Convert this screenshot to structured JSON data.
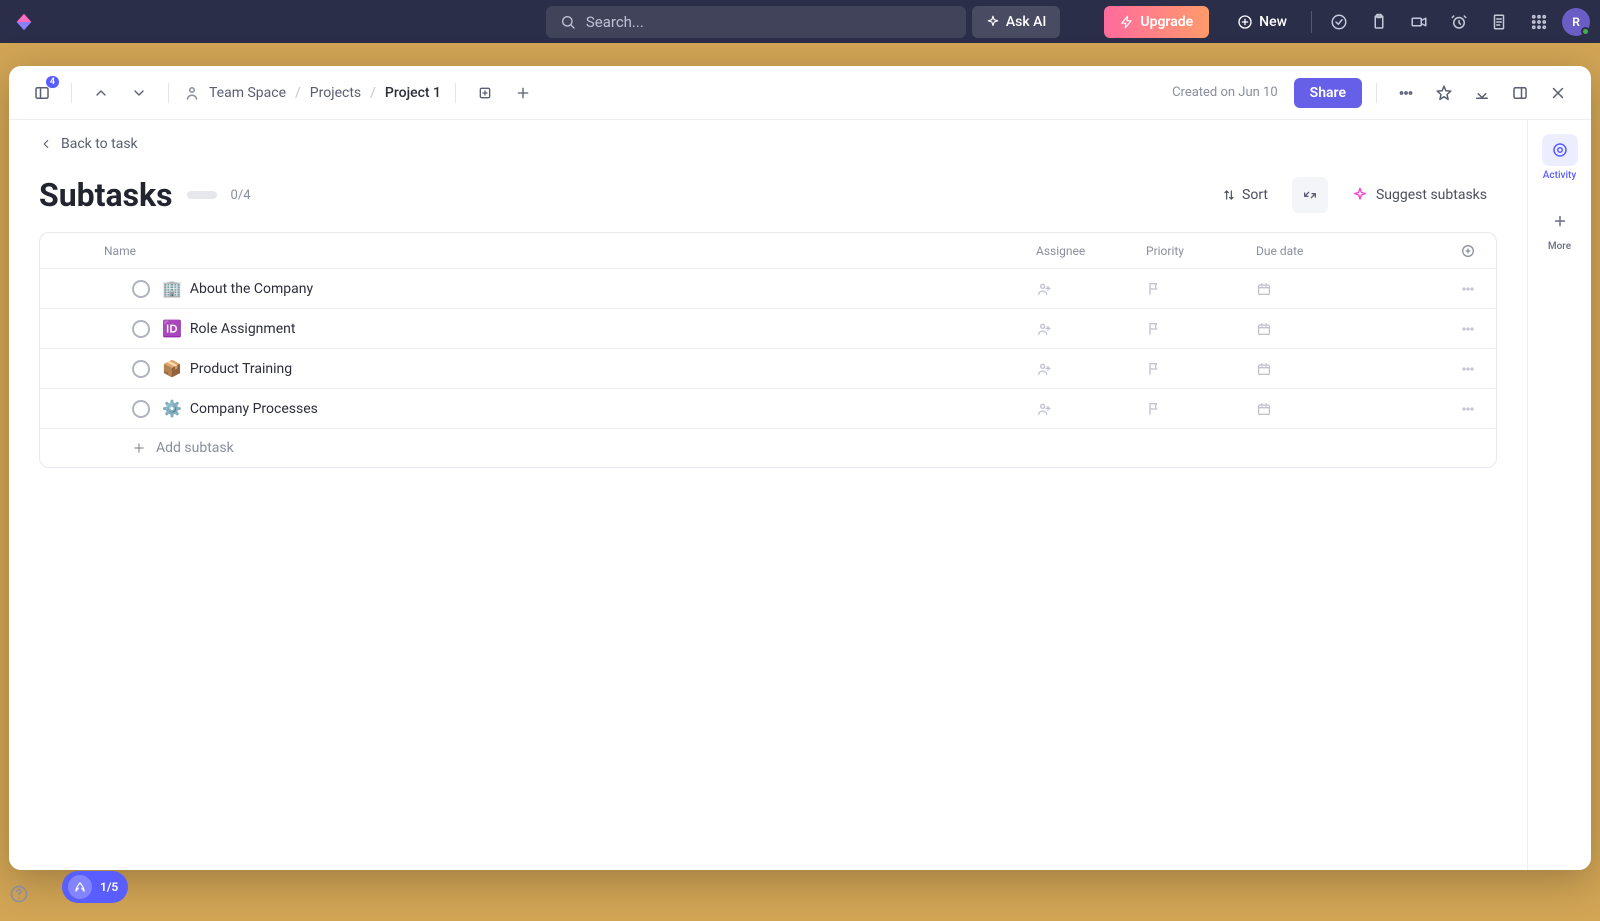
{
  "top": {
    "search_placeholder": "Search...",
    "ask_ai": "Ask AI",
    "upgrade": "Upgrade",
    "new": "New",
    "avatar_initial": "R"
  },
  "modal": {
    "dock_badge": "4",
    "breadcrumb": {
      "space": "Team Space",
      "folder": "Projects",
      "project": "Project 1"
    },
    "created_text": "Created on Jun 10",
    "share": "Share",
    "back": "Back to task",
    "title": "Subtasks",
    "progress": "0/4",
    "sort": "Sort",
    "suggest": "Suggest subtasks",
    "columns": {
      "name": "Name",
      "assignee": "Assignee",
      "priority": "Priority",
      "due": "Due date"
    },
    "rows": [
      {
        "emoji": "🏢",
        "name": "About the Company"
      },
      {
        "emoji": "🆔",
        "name": "Role Assignment"
      },
      {
        "emoji": "📦",
        "name": "Product Training"
      },
      {
        "emoji": "⚙️",
        "name": "Company Processes"
      }
    ],
    "add_subtask": "Add subtask",
    "side": {
      "activity": "Activity",
      "more": "More"
    }
  },
  "dock": {
    "count": "1/5"
  }
}
